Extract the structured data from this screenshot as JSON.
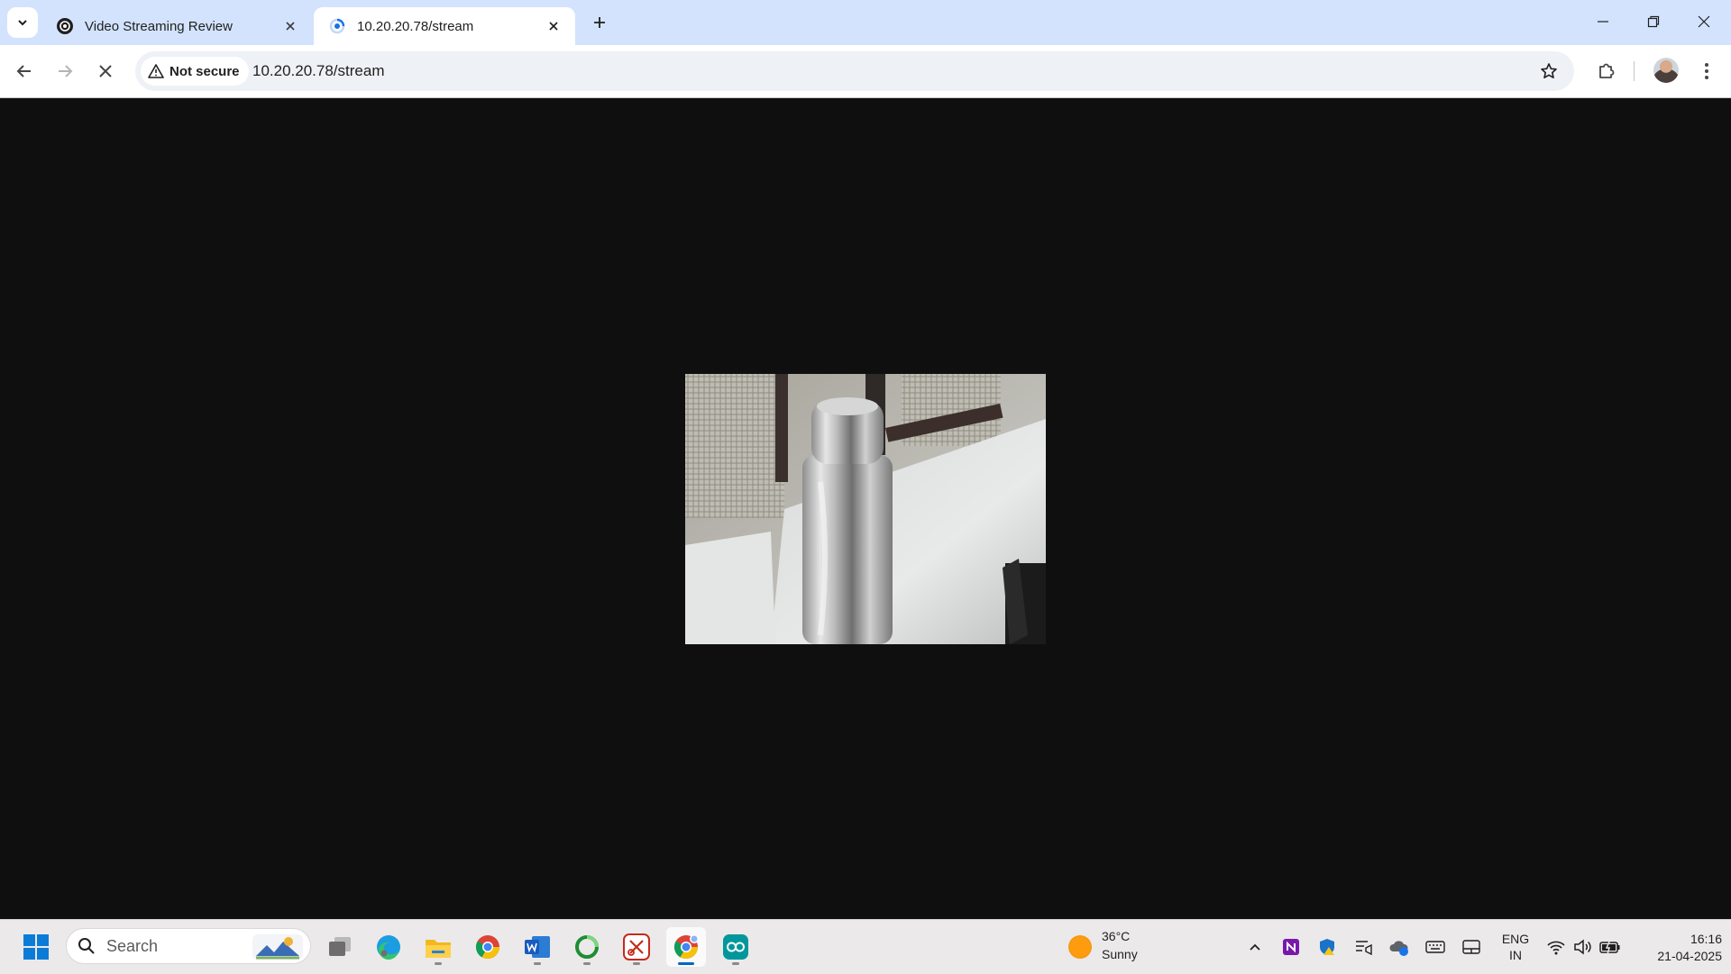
{
  "browser": {
    "tabs": [
      {
        "title": "Video Streaming Review",
        "active": false
      },
      {
        "title": "10.20.20.78/stream",
        "active": true
      }
    ],
    "security_chip": "Not secure",
    "url": "10.20.20.78/stream"
  },
  "content": {
    "stream_image": "Live camera frame showing a stainless steel water bottle on a white surface"
  },
  "taskbar": {
    "search_placeholder": "Search",
    "weather": {
      "temp": "36°C",
      "condition": "Sunny"
    },
    "language": {
      "line1": "ENG",
      "line2": "IN"
    },
    "clock": {
      "time": "16:16",
      "date": "21-04-2025"
    }
  },
  "colors": {
    "tabstrip": "#d3e3fd",
    "page_background": "#0f0f0f",
    "taskbar": "#ece9ea",
    "accent": "#0067c0"
  }
}
